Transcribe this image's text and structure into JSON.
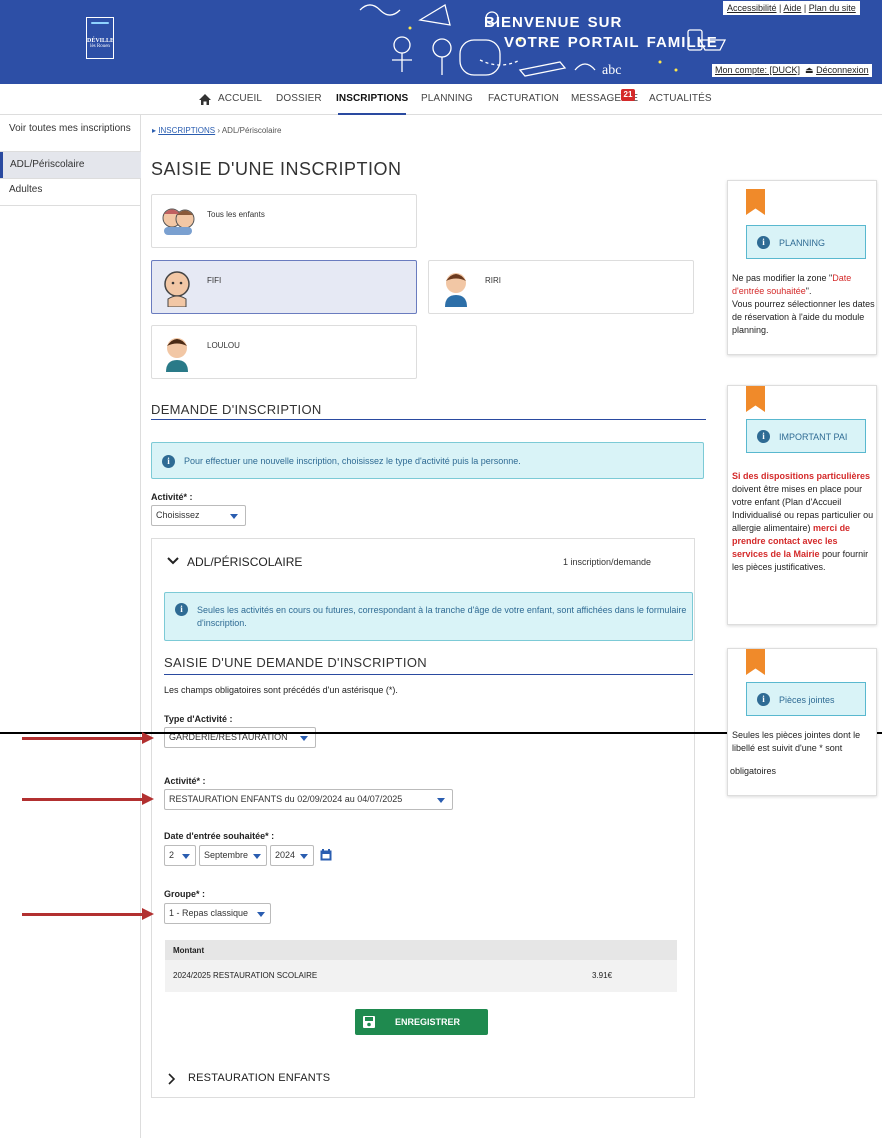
{
  "header": {
    "logo_text": "DÉVILLE",
    "logo_subtext": "lès Rouen",
    "welcome_line1": "bienvenue sur",
    "welcome_line2": "votre portail famille",
    "links": [
      "Accessibilité",
      "Aide",
      "Plan du site"
    ],
    "account_label": "Mon compte: [DUCK]",
    "logout_label": "Déconnexion",
    "brand_color": "#2d4fa6"
  },
  "nav": {
    "items": [
      "ACCUEIL",
      "DOSSIER",
      "INSCRIPTIONS",
      "PLANNING",
      "FACTURATION",
      "MESSAGERIE",
      "ACTUALITÉS"
    ],
    "active": "INSCRIPTIONS",
    "messagerie_badge": "21"
  },
  "sidebar": {
    "items": [
      "Voir toutes mes inscriptions",
      "ADL/Périscolaire",
      "Adultes"
    ],
    "active": "ADL/Périscolaire"
  },
  "breadcrumb": {
    "link": "INSCRIPTIONS",
    "current": "ADL/Périscolaire"
  },
  "page_title": "SAISIE D'UNE INSCRIPTION",
  "children": {
    "all": "Tous les enfants",
    "list": [
      "FIFI",
      "RIRI",
      "LOULOU"
    ],
    "selected": "FIFI"
  },
  "demande": {
    "title": "DEMANDE D'INSCRIPTION",
    "info": "Pour effectuer une nouvelle inscription, choisissez le type d'activité puis la personne.",
    "activite_label": "Activité* :",
    "activite_value": "Choisissez"
  },
  "section": {
    "title": "ADL/PÉRISCOLAIRE",
    "count": "1 inscription/demande",
    "info": "Seules les activités en cours ou futures, correspondant à la tranche d'âge de votre enfant, sont affichées dans le formulaire d'inscription.",
    "subtitle": "SAISIE D'UNE DEMANDE D'INSCRIPTION",
    "note": "Les champs obligatoires sont précédés d'un astérisque (*).",
    "type_label": "Type d'Activité :",
    "type_value": "GARDERIE/RESTAURATION",
    "activite_label": "Activité* :",
    "activite_value": "RESTAURATION ENFANTS du 02/09/2024 au 04/07/2025",
    "date_label": "Date d'entrée souhaitée* :",
    "date_day": "2",
    "date_month": "Septembre",
    "date_year": "2024",
    "groupe_label": "Groupe* :",
    "groupe_value": "1 - Repas classique",
    "table_header": "Montant",
    "table_row_label": "2024/2025 RESTAURATION SCOLAIRE",
    "table_row_value": "3.91€",
    "save_label": "ENREGISTRER",
    "collapsed_title": "RESTAURATION ENFANTS"
  },
  "right_panels": {
    "planning": {
      "button": "PLANNING",
      "text1": "Ne pas modifier la zone \"",
      "text_red": "Date d'entrée souhaitée",
      "text2": "\".",
      "text3": "Vous pourrez sélectionner les dates de réservation à l'aide du module planning."
    },
    "pai": {
      "button": "IMPORTANT PAI",
      "red1": "Si des dispositions particulières",
      "black1": " doivent être mises en place pour votre enfant (Plan d'Accueil Individualisé ou repas particulier ou allergie alimentaire) ",
      "red2": "merci de prendre contact avec les services de la Mairie",
      "black2": " pour fournir les pièces justificatives."
    },
    "pieces": {
      "button": "Pièces jointes",
      "text1": "Seules les pièces jointes dont le libellé est suivit d'une * sont",
      "text2": "obligatoires"
    }
  },
  "colors": {
    "accent": "#2a4aa0",
    "save_green": "#1f8a4f",
    "bookmark_orange": "#f08a2a",
    "arrow_red": "#b23030",
    "info_bg": "#d9f3f7"
  }
}
